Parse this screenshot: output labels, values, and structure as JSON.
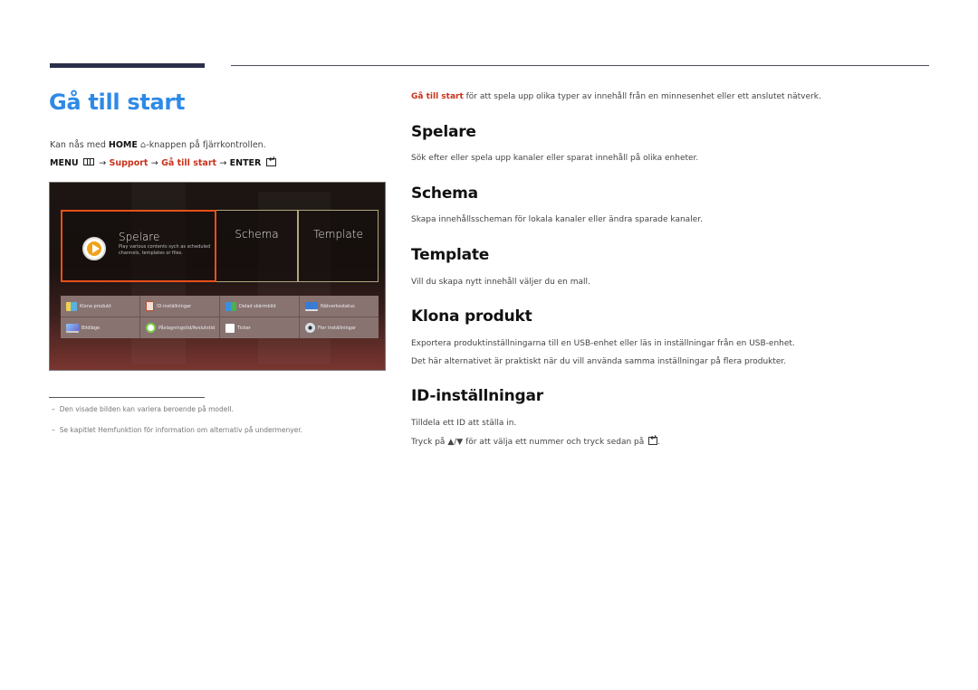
{
  "page": {
    "title": "Gå till start"
  },
  "left": {
    "home_line": {
      "prefix": "Kan nås med ",
      "key": "HOME",
      "icon": "home-icon",
      "suffix": "-knappen på fjärrkontrollen."
    },
    "menu_path": {
      "menu": "MENU",
      "arrow": "→",
      "support": "Support",
      "target": "Gå till start",
      "enter": "ENTER"
    },
    "screen": {
      "tiles": [
        {
          "label": "Spelare",
          "desc": "Play various contents sych as scheduled channels, templates or files.",
          "icon": "play-icon",
          "selected": true
        },
        {
          "label": "Schema"
        },
        {
          "label": "Template"
        }
      ],
      "grid": [
        {
          "label": "Klona produkt",
          "icon": "clone-product-icon"
        },
        {
          "label": "ID-inställningar",
          "icon": "id-settings-icon"
        },
        {
          "label": "Delad skärmbild",
          "icon": "split-screen-icon"
        },
        {
          "label": "Nätverksstatus",
          "icon": "network-status-icon"
        },
        {
          "label": "Bildläge",
          "icon": "picture-mode-icon"
        },
        {
          "label": "Påslagningstid/Avslutstid",
          "icon": "on-off-timer-icon"
        },
        {
          "label": "Ticker",
          "icon": "ticker-icon"
        },
        {
          "label": "Fler inställningar",
          "icon": "more-settings-icon"
        }
      ],
      "colors": {
        "selected_border": "#e8501a",
        "tile_border": "#b0a57a"
      }
    },
    "footnotes": [
      "Den visade bilden kan variera beroende på modell.",
      "Se kapitlet Hemfunktion för information om alternativ på undermenyer."
    ]
  },
  "right": {
    "intro": {
      "highlight": "Gå till start",
      "text": " för att spela upp olika typer av innehåll från en minnesenhet eller ett anslutet nätverk."
    },
    "sections": [
      {
        "title": "Spelare",
        "lines": [
          "Sök efter eller spela upp kanaler eller sparat innehåll på olika enheter."
        ]
      },
      {
        "title": "Schema",
        "lines": [
          "Skapa innehållsscheman för lokala kanaler eller ändra sparade kanaler."
        ]
      },
      {
        "title": "Template",
        "lines": [
          "Vill du skapa nytt innehåll väljer du en mall."
        ]
      },
      {
        "title": "Klona produkt",
        "lines": [
          "Exportera produktinställningarna till en USB-enhet eller läs in inställningar från en USB-enhet.",
          "Det här alternativet är praktiskt när du vill använda samma inställningar på flera produkter."
        ]
      },
      {
        "title": "ID-inställningar",
        "lines": [
          "Tilldela ett ID att ställa in.",
          "för att välja ett nummer och tryck sedan på"
        ]
      }
    ],
    "id_press_prefix": "Tryck på ",
    "id_arrows": "▲/▼",
    "id_end": "."
  },
  "colors": {
    "title_blue": "#2e8ae6",
    "accent_red": "#c8321a",
    "rule_dark": "#2b2f4a"
  }
}
